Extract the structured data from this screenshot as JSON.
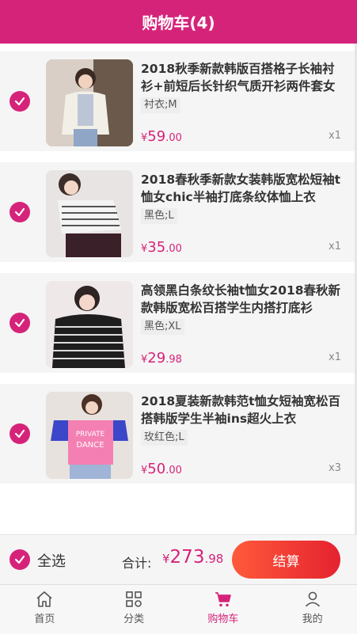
{
  "header": {
    "title": "购物车(4)"
  },
  "items": [
    {
      "title": "2018秋季新款韩版百搭格子长袖衬衫+前短后长针织气质开衫两件套女",
      "spec": "衬衣;M",
      "currency": "¥",
      "price_int": "59",
      "price_dec": ".00",
      "qty": "x1",
      "checked": true
    },
    {
      "title": "2018春秋季新款女装韩版宽松短袖t恤女chic半袖打底条纹体恤上衣",
      "spec": "黑色;L",
      "currency": "¥",
      "price_int": "35",
      "price_dec": ".00",
      "qty": "x1",
      "checked": true
    },
    {
      "title": "高领黑白条纹长袖t恤女2018春秋新款韩版宽松百搭学生内搭打底衫",
      "spec": "黑色;XL",
      "currency": "¥",
      "price_int": "29",
      "price_dec": ".98",
      "qty": "x1",
      "checked": true
    },
    {
      "title": "2018夏装新款韩范t恤女短袖宽松百搭韩版学生半袖ins超火上衣",
      "spec": "玫红色;L",
      "currency": "¥",
      "price_int": "50",
      "price_dec": ".00",
      "qty": "x3",
      "checked": true
    }
  ],
  "footer": {
    "select_all": "全选",
    "total_label": "合计:",
    "currency": "¥",
    "total_int": "273",
    "total_dec": ".98",
    "checkout": "结算"
  },
  "tabs": [
    {
      "label": "首页",
      "icon": "home-icon",
      "active": false
    },
    {
      "label": "分类",
      "icon": "category-icon",
      "active": false
    },
    {
      "label": "购物车",
      "icon": "cart-icon",
      "active": true
    },
    {
      "label": "我的",
      "icon": "user-icon",
      "active": false
    }
  ],
  "colors": {
    "accent": "#d6237a",
    "checkout_start": "#ff5a3b",
    "checkout_end": "#e5222f"
  }
}
